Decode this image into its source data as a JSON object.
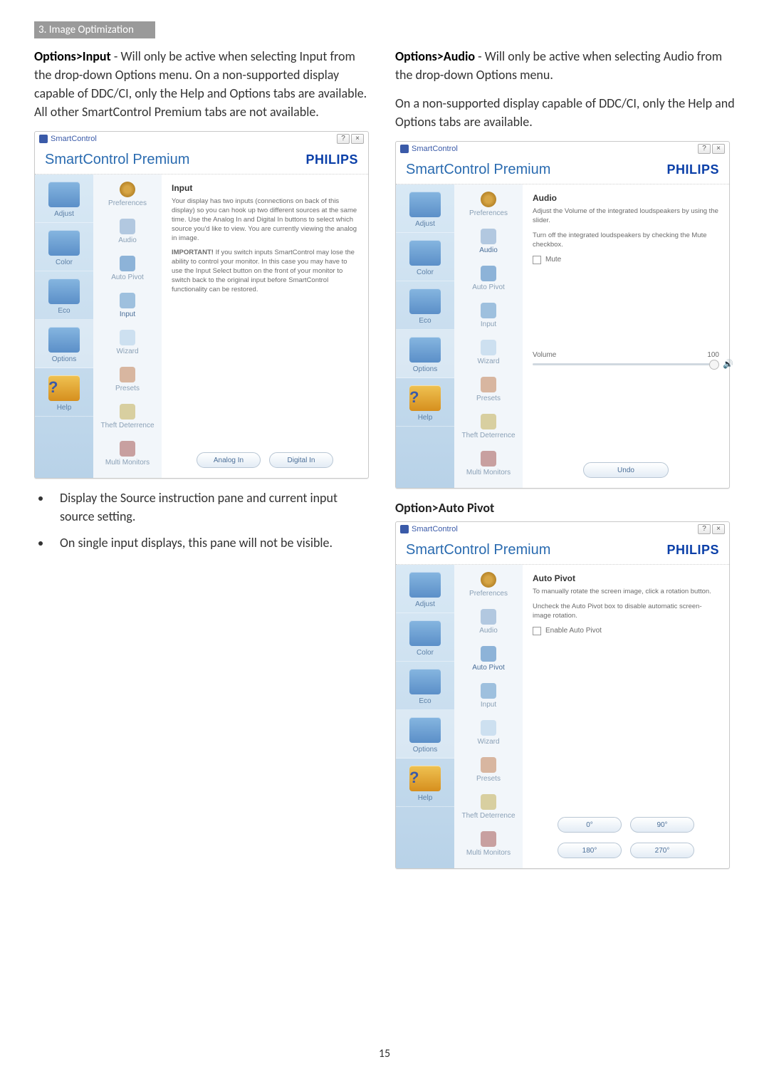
{
  "section_header": "3. Image Optimization",
  "left": {
    "para1_bold": "Options>Input",
    "para1_rest": " - Will only be active when selecting Input from the drop-down Options menu. On a non-supported display capable of DDC/CI, only the Help and Options tabs are available. All other SmartControl Premium tabs are not available.",
    "bullets": [
      "Display the Source instruction pane and current input source setting.",
      "On single input displays, this pane will not be visible."
    ]
  },
  "right": {
    "para1_bold": "Options>Audio",
    "para1_rest": " - Will only be active when selecting Audio from the drop-down Options menu.",
    "para2": "On a non-supported display capable of DDC/CI, only the Help and Options tabs are available.",
    "subhead": "Option>Auto Pivot"
  },
  "win_common": {
    "titlebar": "SmartControl",
    "product": "SmartControl Premium",
    "brand": "PHILIPS",
    "help_btn": "?",
    "close_btn": "×",
    "sidebar": [
      "Adjust",
      "Color",
      "Eco",
      "Options",
      "Help"
    ],
    "subnav": [
      "Preferences",
      "Audio",
      "Auto Pivot",
      "Input",
      "Wizard",
      "Presets",
      "Theft Deterrence",
      "Multi Monitors"
    ]
  },
  "win_input": {
    "title": "Input",
    "p1": "Your display has two inputs (connections on back of this display) so you can hook up two different sources at the same time. Use the Analog In and Digital In buttons to select which source you'd like to view. You are currently viewing the analog in image.",
    "p2_bold": "IMPORTANT!",
    "p2_rest": " If you switch inputs SmartControl may lose the ability to control your monitor. In this case you may have to use the Input Select button on the front of your monitor to switch back to the original input before SmartControl functionality can be restored.",
    "btn1": "Analog In",
    "btn2": "Digital In"
  },
  "win_audio": {
    "title": "Audio",
    "p1": "Adjust the Volume of the integrated loudspeakers by using the slider.",
    "p2": "Turn off the integrated loudspeakers by checking the Mute checkbox.",
    "mute": "Mute",
    "vol_label": "Volume",
    "vol_value": "100",
    "undo": "Undo"
  },
  "win_pivot": {
    "title": "Auto Pivot",
    "p1": "To manually rotate the screen image, click a rotation button.",
    "p2": "Uncheck the Auto Pivot box to disable automatic screen-image rotation.",
    "enable": "Enable Auto Pivot",
    "b0": "0°",
    "b90": "90°",
    "b180": "180°",
    "b270": "270°"
  },
  "page_number": "15"
}
